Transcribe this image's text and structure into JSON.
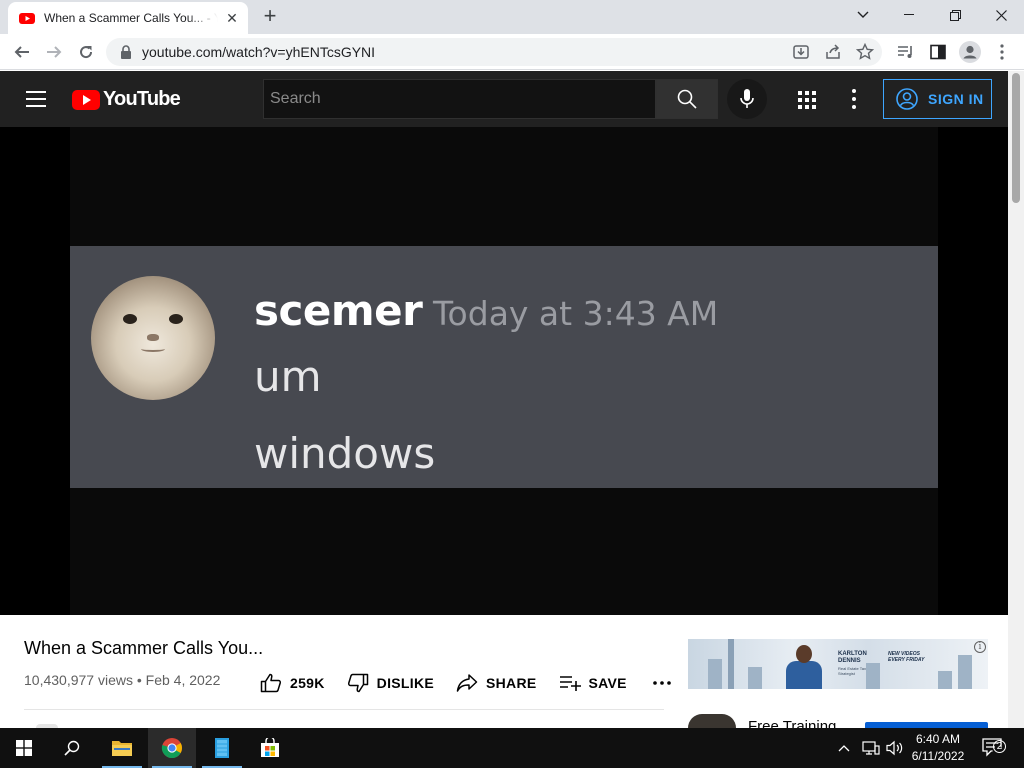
{
  "browser": {
    "tab_title": "When a Scammer Calls You... - YouTube",
    "url": "youtube.com/watch?v=yhENTcsGYNI"
  },
  "youtube": {
    "logo_text": "YouTube",
    "search_placeholder": "Search",
    "signin_label": "SIGN IN"
  },
  "video_frame": {
    "username": "scemer",
    "timestamp": "Today at 3:43 AM",
    "line1": "um",
    "line2": "windows"
  },
  "video": {
    "title": "When a Scammer Calls You...",
    "meta": "10,430,977 views • Feb 4, 2022",
    "likes": "259K",
    "dislike_label": "DISLIKE",
    "share_label": "SHARE",
    "save_label": "SAVE",
    "more_label": "..."
  },
  "ad": {
    "brand": "KARLTON DENNIS",
    "sub": "Real Estate Tax Strategist",
    "promo": "NEW VIDEOS EVERY FRIDAY",
    "info": "i"
  },
  "recommendation": {
    "title": "Free Training"
  },
  "taskbar": {
    "time": "6:40 AM",
    "date": "6/11/2022",
    "notifications": "2"
  },
  "colors": {
    "yt_red": "#ff0000",
    "signin_blue": "#3ea6ff",
    "masthead": "#212121",
    "message_bg": "#474950"
  }
}
